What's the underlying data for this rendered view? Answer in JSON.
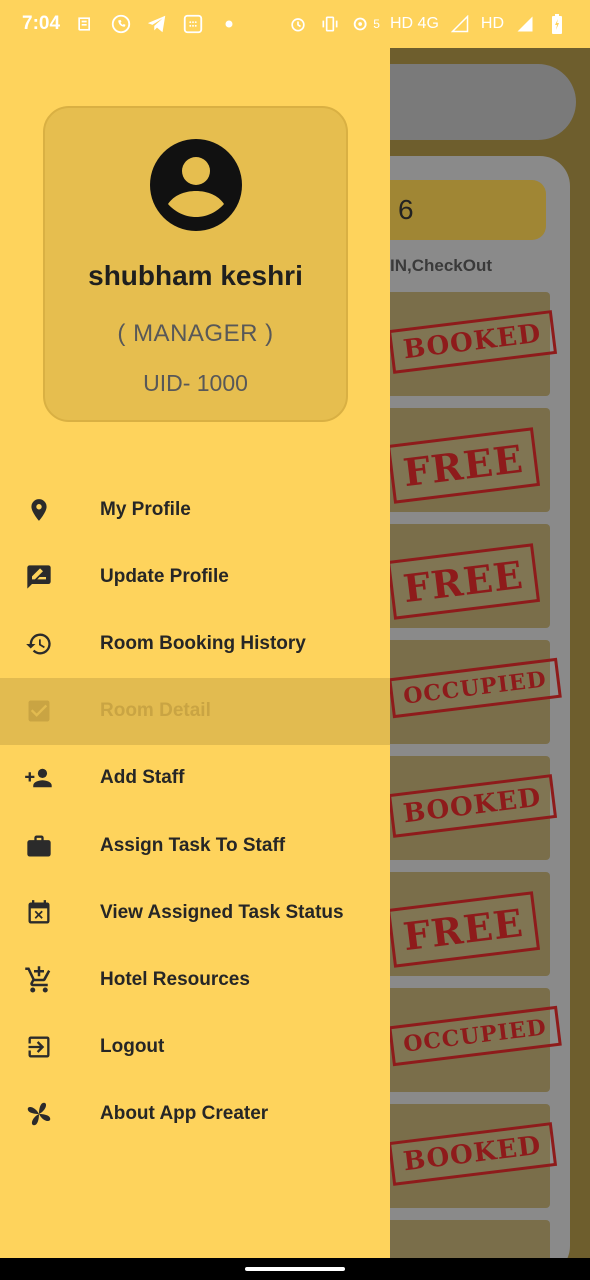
{
  "status_bar": {
    "time": "7:04",
    "network": "HD 4G",
    "network2": "HD",
    "speed": "5"
  },
  "profile": {
    "name": "shubham keshri",
    "role": "( MANAGER )",
    "uid": "UID- 1000"
  },
  "menu": [
    {
      "label": "My Profile",
      "icon": "location-pin-icon"
    },
    {
      "label": "Update Profile",
      "icon": "rate-review-icon"
    },
    {
      "label": "Room Booking History",
      "icon": "history-icon"
    },
    {
      "label": "Room Detail",
      "icon": "check-box-icon",
      "active": true
    },
    {
      "label": "Add Staff",
      "icon": "person-add-icon"
    },
    {
      "label": "Assign Task To Staff",
      "icon": "briefcase-icon"
    },
    {
      "label": "View Assigned Task Status",
      "icon": "event-busy-icon"
    },
    {
      "label": "Hotel Resources",
      "icon": "add-shopping-cart-icon"
    },
    {
      "label": "Logout",
      "icon": "exit-to-app-icon"
    },
    {
      "label": "About App Creater",
      "icon": "pinwheel-icon"
    }
  ],
  "background": {
    "pill_text": "6",
    "subheading": "IN,CheckOut",
    "stamps": [
      "BOOKED",
      "FREE",
      "FREE",
      "OCCUPIED",
      "BOOKED",
      "FREE",
      "OCCUPIED",
      "BOOKED"
    ]
  }
}
